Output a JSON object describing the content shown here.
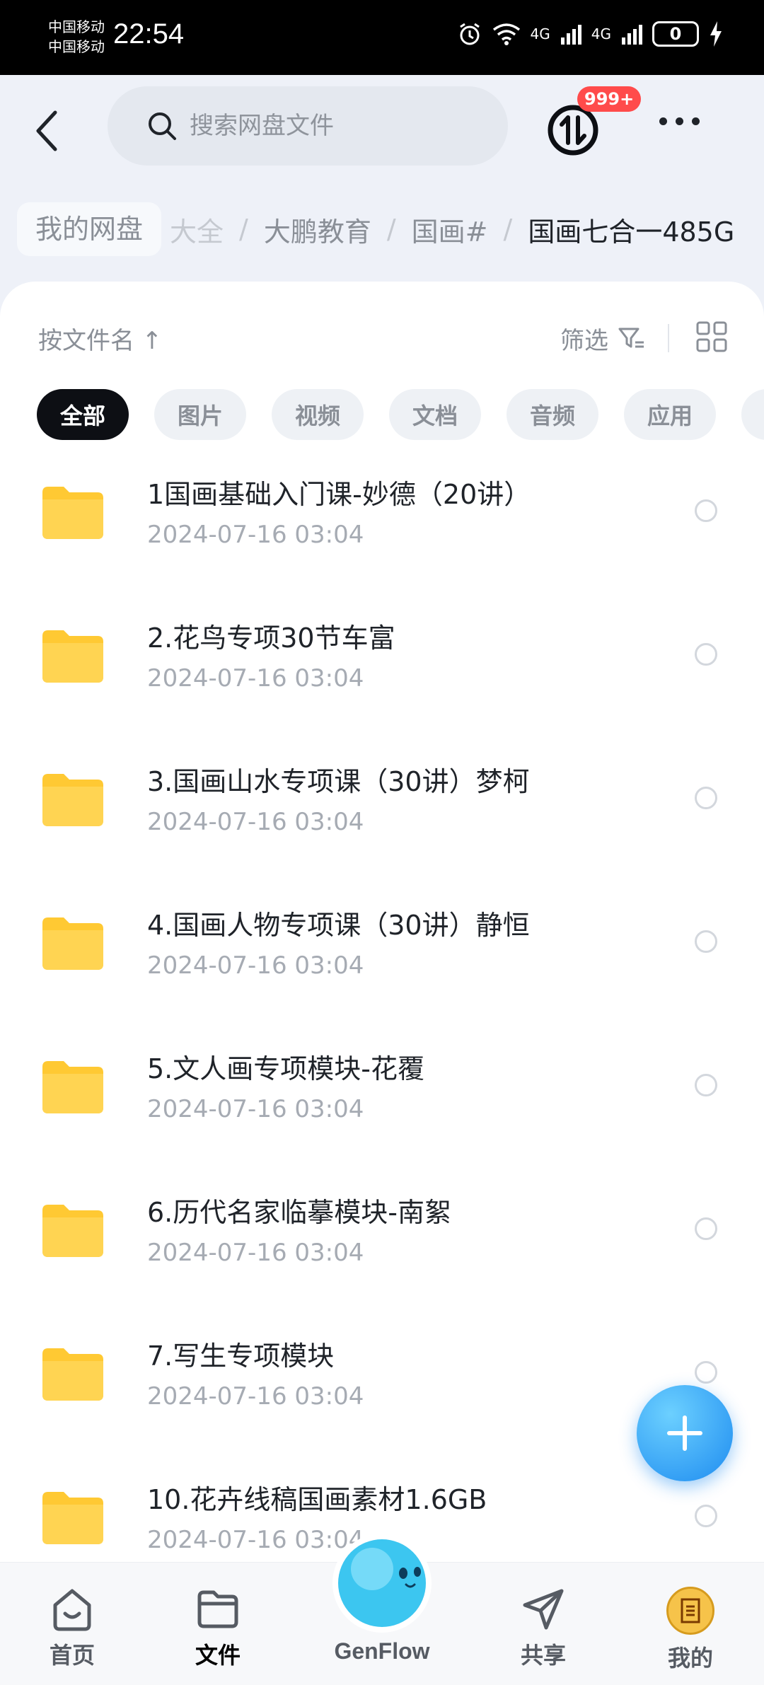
{
  "status_bar": {
    "carrier_1": "中国移动",
    "carrier_2": "中国移动",
    "time": "22:54",
    "signal_1": "4G",
    "signal_2": "4G",
    "battery": "0"
  },
  "header": {
    "search_placeholder": "搜索网盘文件",
    "transfer_badge": "999+"
  },
  "breadcrumb": {
    "root": "我的网盘",
    "partial": "大全",
    "items": [
      "大鹏教育",
      "国画#"
    ],
    "current": "国画七合一485G",
    "separator": "/"
  },
  "toolbar": {
    "sort_label": "按文件名 ↑",
    "filter_label": "筛选"
  },
  "filter_chips": [
    "全部",
    "图片",
    "视频",
    "文档",
    "音频",
    "应用"
  ],
  "files": [
    {
      "name": "1国画基础入门课-妙德（20讲）",
      "date": "2024-07-16  03:04"
    },
    {
      "name": "2.花鸟专项30节车富",
      "date": "2024-07-16  03:04"
    },
    {
      "name": "3.国画山水专项课（30讲）梦柯",
      "date": "2024-07-16  03:04"
    },
    {
      "name": "4.国画人物专项课（30讲）静恒",
      "date": "2024-07-16  03:04"
    },
    {
      "name": "5.文人画专项模块-花覆",
      "date": "2024-07-16  03:04"
    },
    {
      "name": "6.历代名家临摹模块-南絮",
      "date": "2024-07-16  03:04"
    },
    {
      "name": "7.写生专项模块",
      "date": "2024-07-16  03:04"
    },
    {
      "name": "10.花卉线稿国画素材1.6GB",
      "date": "2024-07-16  03:04"
    }
  ],
  "bottom_nav": {
    "home": "首页",
    "files": "文件",
    "genflow": "GenFlow",
    "share": "共享",
    "mine": "我的"
  },
  "colors": {
    "accent": "#1e8cf0",
    "badge": "#ff4b4b",
    "folder": "#ffc933"
  }
}
